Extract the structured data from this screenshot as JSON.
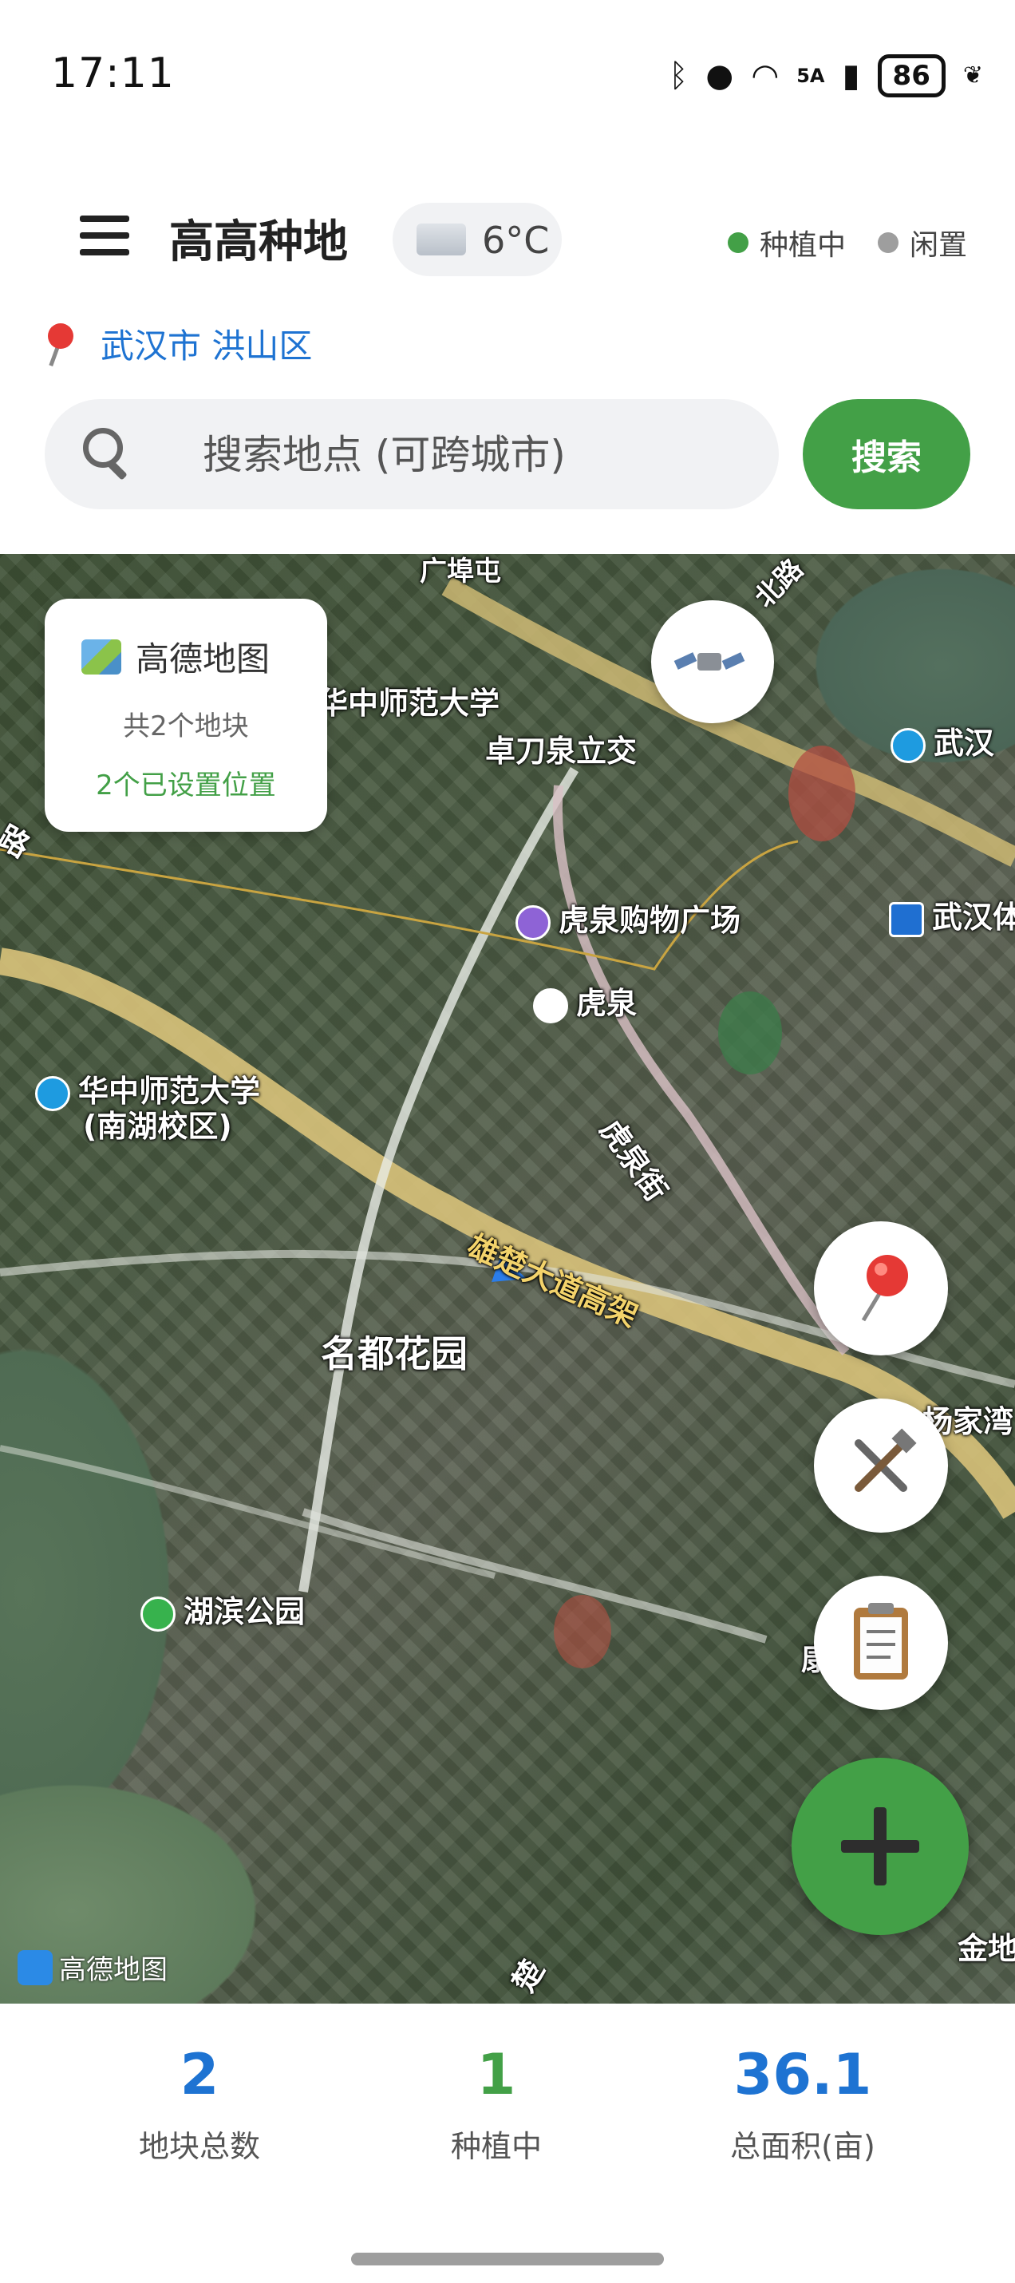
{
  "status_bar": {
    "time": "17:11",
    "network": "5A",
    "battery": "86"
  },
  "header": {
    "title": "高高种地",
    "temperature": "6°C",
    "legend": [
      {
        "label": "种植中",
        "color": "#43a047"
      },
      {
        "label": "闲置",
        "color": "#9e9e9e"
      }
    ]
  },
  "location": {
    "text": "武汉市 洪山区"
  },
  "search": {
    "placeholder": "搜索地点 (可跨城市)",
    "value": "",
    "button_label": "搜索"
  },
  "info_card": {
    "title": "高德地图",
    "count_text": "共2个地块",
    "set_text": "2个已设置位置"
  },
  "map_labels": [
    "广埠屯",
    "华中师范大学",
    "卓刀泉立交",
    "武汉",
    "虎泉购物广场",
    "武汉体",
    "虎泉",
    "华中师范大学",
    "(南湖校区)",
    "虎泉街",
    "雄楚大道高架",
    "名都花园",
    "杨家湾",
    "湖滨公园",
    "康城",
    "金地",
    "北路",
    "路",
    "楚"
  ],
  "map_attribution": "高德地图",
  "stats": [
    {
      "value": "2",
      "label": "地块总数",
      "color": "#1e73d2"
    },
    {
      "value": "1",
      "label": "种植中",
      "color": "#43a047"
    },
    {
      "value": "36.1",
      "label": "总面积(亩)",
      "color": "#1e73d2"
    }
  ]
}
